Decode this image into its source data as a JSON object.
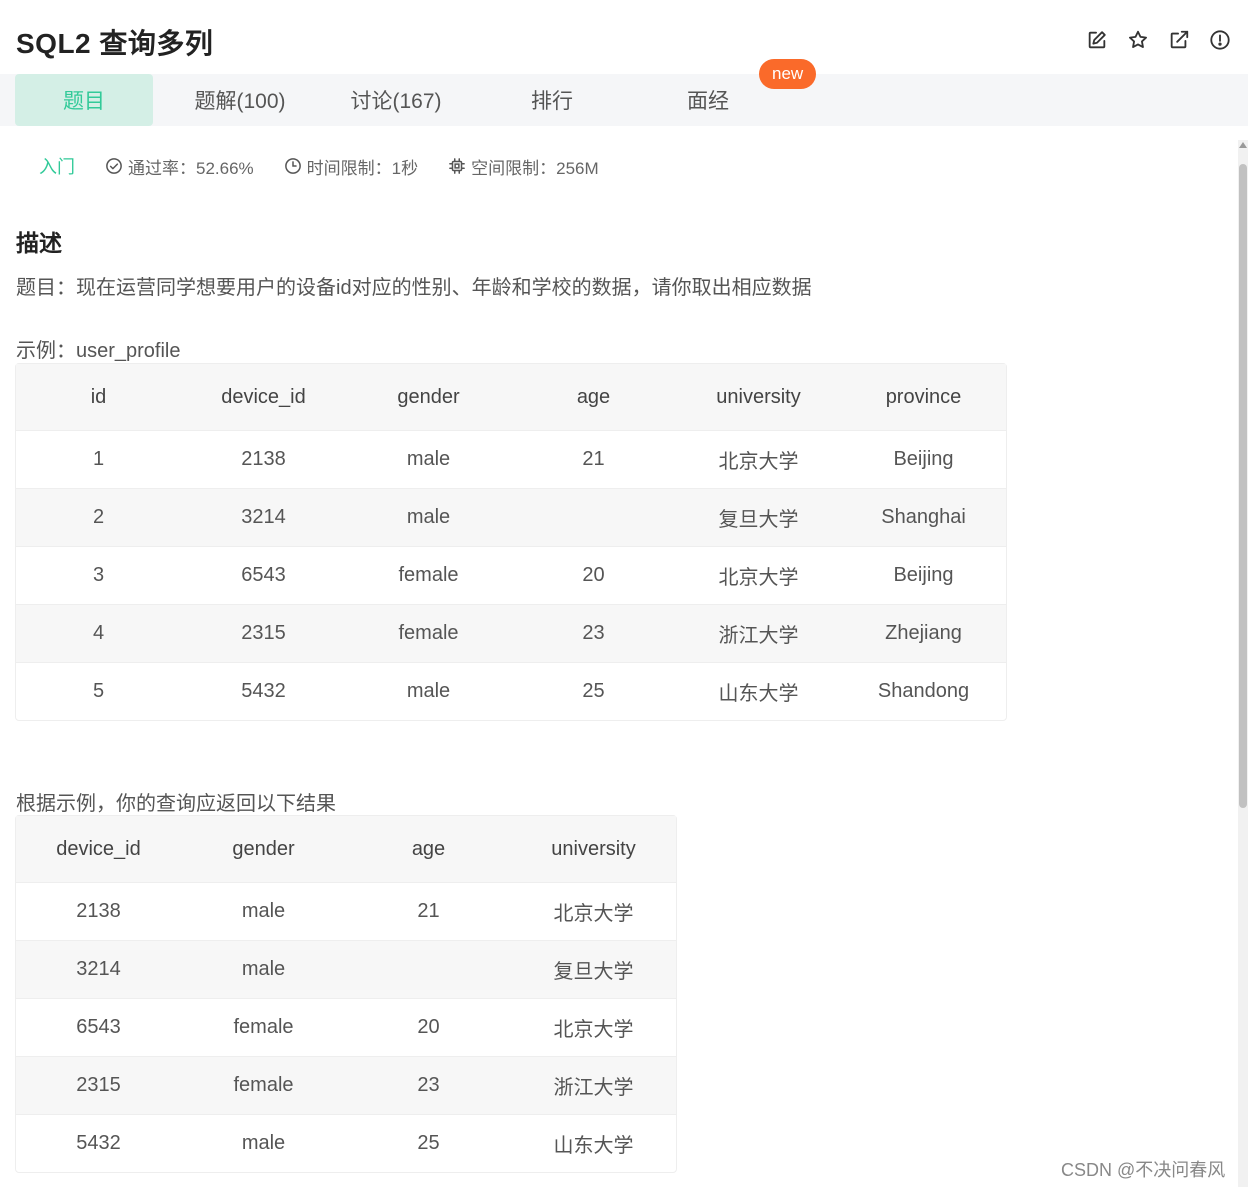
{
  "header": {
    "title": "SQL2  查询多列",
    "tool_icons": [
      "edit-icon",
      "star-icon",
      "external-link-icon",
      "alert-icon"
    ]
  },
  "tabs": [
    {
      "label": "题目",
      "active": true
    },
    {
      "label": "题解(100)"
    },
    {
      "label": "讨论(167)"
    },
    {
      "label": "排行"
    },
    {
      "label": "面经"
    }
  ],
  "badge_new": "new",
  "meta": {
    "level": "入门",
    "pass_rate": "通过率：52.66%",
    "time_limit": "时间限制：1秒",
    "space_limit": "空间限制：256M"
  },
  "description": {
    "heading": "描述",
    "text": "题目：现在运营同学想要用户的设备id对应的性别、年龄和学校的数据，请你取出相应数据"
  },
  "example": {
    "caption": "示例：user_profile",
    "columns": [
      "id",
      "device_id",
      "gender",
      "age",
      "university",
      "province"
    ],
    "rows": [
      [
        "1",
        "2138",
        "male",
        "21",
        "北京大学",
        "Beijing"
      ],
      [
        "2",
        "3214",
        "male",
        "",
        "复旦大学",
        "Shanghai"
      ],
      [
        "3",
        "6543",
        "female",
        "20",
        "北京大学",
        "Beijing"
      ],
      [
        "4",
        "2315",
        "female",
        "23",
        "浙江大学",
        "Zhejiang"
      ],
      [
        "5",
        "5432",
        "male",
        "25",
        "山东大学",
        "Shandong"
      ]
    ]
  },
  "result": {
    "caption": "根据示例，你的查询应返回以下结果",
    "columns": [
      "device_id",
      "gender",
      "age",
      "university"
    ],
    "rows": [
      [
        "2138",
        "male",
        "21",
        "北京大学"
      ],
      [
        "3214",
        "male",
        "",
        "复旦大学"
      ],
      [
        "6543",
        "female",
        "20",
        "北京大学"
      ],
      [
        "2315",
        "female",
        "23",
        "浙江大学"
      ],
      [
        "5432",
        "male",
        "25",
        "山东大学"
      ]
    ]
  },
  "watermark": "CSDN @不决问春风",
  "colors": {
    "accent": "#32ca99",
    "active_tab_bg": "#d4efe6",
    "badge": "#fa6a2a"
  }
}
